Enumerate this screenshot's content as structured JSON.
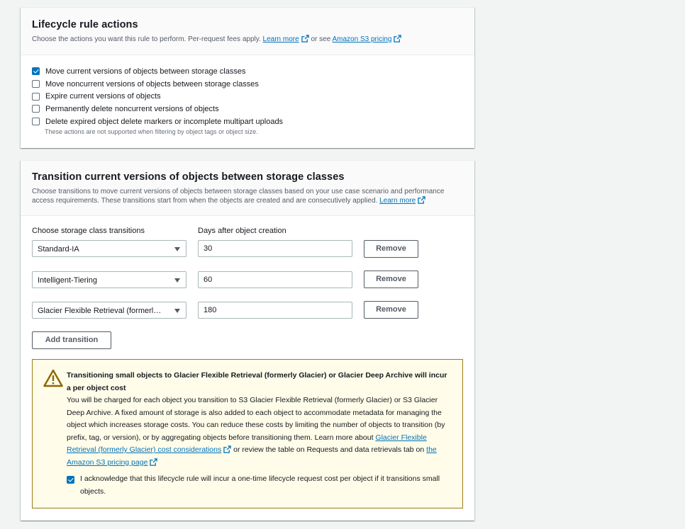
{
  "actions": {
    "title": "Lifecycle rule actions",
    "description": "Choose the actions you want this rule to perform. Per-request fees apply.",
    "learn_more": "Learn more",
    "or_see": "or see",
    "pricing_link": "Amazon S3 pricing",
    "options": [
      {
        "label": "Move current versions of objects between storage classes",
        "checked": true
      },
      {
        "label": "Move noncurrent versions of objects between storage classes",
        "checked": false
      },
      {
        "label": "Expire current versions of objects",
        "checked": false
      },
      {
        "label": "Permanently delete noncurrent versions of objects",
        "checked": false
      },
      {
        "label": "Delete expired object delete markers or incomplete multipart uploads",
        "checked": false
      }
    ],
    "note": "These actions are not supported when filtering by object tags or object size."
  },
  "transitions": {
    "title": "Transition current versions of objects between storage classes",
    "description": "Choose transitions to move current versions of objects between storage classes based on your use case scenario and performance access requirements. These transitions start from when the objects are created and are consecutively applied.",
    "learn_more": "Learn more",
    "col_storage": "Choose storage class transitions",
    "col_days": "Days after object creation",
    "rows": [
      {
        "storage_class": "Standard-IA",
        "days": "30",
        "remove": "Remove"
      },
      {
        "storage_class": "Intelligent-Tiering",
        "days": "60",
        "remove": "Remove"
      },
      {
        "storage_class": "Glacier Flexible Retrieval (formerl…",
        "days": "180",
        "remove": "Remove"
      }
    ],
    "add_button": "Add transition"
  },
  "warning": {
    "title": "Transitioning small objects to Glacier Flexible Retrieval (formerly Glacier) or Glacier Deep Archive will incur a per object cost",
    "body": "You will be charged for each object you transition to S3 Glacier Flexible Retrieval (formerly Glacier) or S3 Glacier Deep Archive. A fixed amount of storage is also added to each object to accommodate metadata for managing the object which increases storage costs. You can reduce these costs by limiting the number of objects to transition (by prefix, tag, or version), or by aggregating objects before transitioning them. Learn more about",
    "link1": "Glacier Flexible Retrieval (formerly Glacier) cost considerations",
    "middle": "or review the table on Requests and data retrievals tab on",
    "link2": "the Amazon S3 pricing page",
    "ack_label": "I acknowledge that this lifecycle rule will incur a one-time lifecycle request cost per object if it transitions small objects.",
    "ack_checked": true
  },
  "colors": {
    "link": "#0073bb",
    "checkbox": "#0073bb",
    "warning_bg": "#fffce9",
    "warning_icon": "#8d6605"
  }
}
